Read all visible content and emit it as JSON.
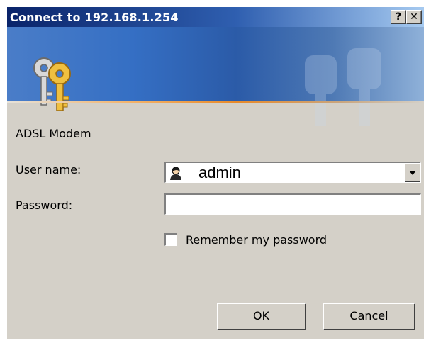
{
  "window": {
    "title": "Connect to 192.168.1.254",
    "help_label": "?",
    "close_label": "✕",
    "icon": "keys-icon"
  },
  "banner": {
    "icon": "keys-icon",
    "watermark": "keys-watermark-icon",
    "colors": {
      "gradient_start": "#0a246a",
      "gradient_end": "#a6caf0",
      "accent": "#e88a2a"
    }
  },
  "form": {
    "realm": "ADSL Modem",
    "username_label": "User name:",
    "username_value": "admin",
    "username_icon": "user-icon",
    "password_label": "Password:",
    "password_value": "",
    "remember_label": "Remember my password",
    "remember_checked": false
  },
  "buttons": {
    "ok": "OK",
    "cancel": "Cancel"
  }
}
